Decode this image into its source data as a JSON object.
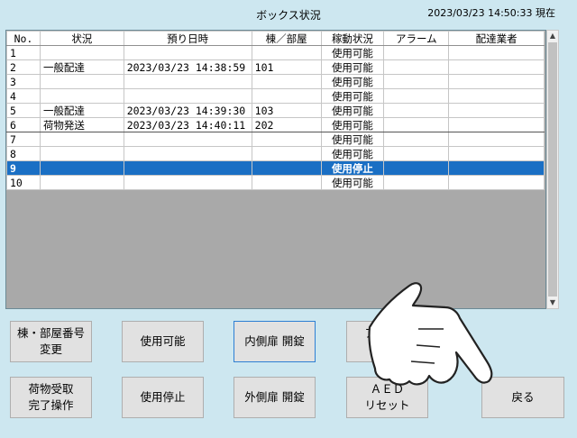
{
  "header": {
    "title": "ボックス状況",
    "timestamp": "2023/03/23 14:50:33 現在"
  },
  "table": {
    "columns": [
      "No.",
      "状況",
      "預り日時",
      "棟／部屋",
      "稼動状況",
      "アラーム",
      "配達業者"
    ],
    "rows": [
      {
        "no": "1",
        "status": "",
        "datetime": "",
        "room": "",
        "move": "使用可能",
        "alarm": "",
        "courier": ""
      },
      {
        "no": "2",
        "status": "一般配達",
        "datetime": "2023/03/23 14:38:59",
        "room": "101",
        "move": "使用可能",
        "alarm": "",
        "courier": ""
      },
      {
        "no": "3",
        "status": "",
        "datetime": "",
        "room": "",
        "move": "使用可能",
        "alarm": "",
        "courier": ""
      },
      {
        "no": "4",
        "status": "",
        "datetime": "",
        "room": "",
        "move": "使用可能",
        "alarm": "",
        "courier": ""
      },
      {
        "no": "5",
        "status": "一般配達",
        "datetime": "2023/03/23 14:39:30",
        "room": "103",
        "move": "使用可能",
        "alarm": "",
        "courier": ""
      },
      {
        "no": "6",
        "status": "荷物発送",
        "datetime": "2023/03/23 14:40:11",
        "room": "202",
        "move": "使用可能",
        "alarm": "",
        "courier": ""
      },
      {
        "no": "7",
        "status": "",
        "datetime": "",
        "room": "",
        "move": "使用可能",
        "alarm": "",
        "courier": ""
      },
      {
        "no": "8",
        "status": "",
        "datetime": "",
        "room": "",
        "move": "使用可能",
        "alarm": "",
        "courier": ""
      },
      {
        "no": "9",
        "status": "",
        "datetime": "",
        "room": "",
        "move": "使用停止",
        "alarm": "",
        "courier": ""
      },
      {
        "no": "10",
        "status": "",
        "datetime": "",
        "room": "",
        "move": "使用可能",
        "alarm": "",
        "courier": ""
      }
    ]
  },
  "buttons": {
    "room_change": "棟・部屋番号\n変更",
    "enable": "使用可能",
    "inner_door": "内側扉 開錠",
    "alarm_release": "アラーム\n解除",
    "pickup_done": "荷物受取\n完了操作",
    "disable": "使用停止",
    "outer_door": "外側扉 開錠",
    "aed_reset": "ＡＥＤ\nリセット",
    "back": "戻る"
  },
  "colors": {
    "background": "#cde7f0",
    "selected_row": "#1a6fc4",
    "button": "#e1e1e1"
  },
  "icons": {
    "pointer": "pointing-hand-icon",
    "scroll_up": "chevron-up-icon",
    "scroll_down": "chevron-down-icon"
  }
}
